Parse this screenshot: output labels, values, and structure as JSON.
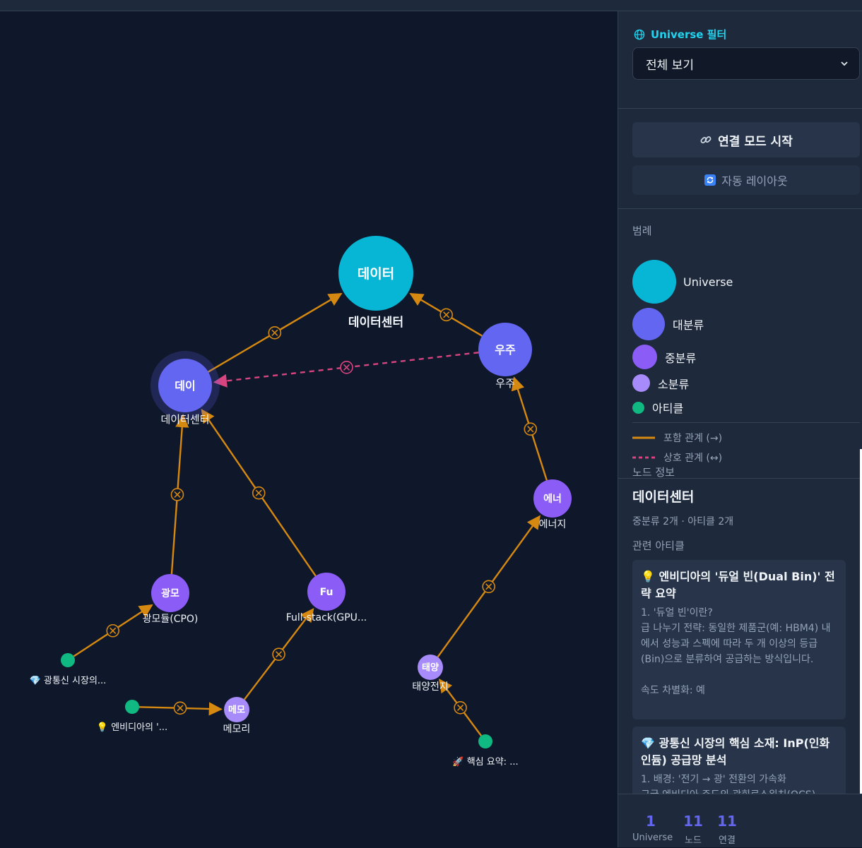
{
  "colors": {
    "universe": "#06b6d4",
    "major": "#6366f1",
    "middle": "#8b5cf6",
    "minor": "#a78bfa",
    "article": "#10b981",
    "contains": "#d68910",
    "mutual": "#d6457f"
  },
  "graph": {
    "nodes": [
      {
        "id": "universe-dc",
        "type": "universe",
        "label": "데이터",
        "caption": "데이터센터"
      },
      {
        "id": "major-dc",
        "type": "major",
        "label": "데이",
        "caption": "데이터센터",
        "selected": true
      },
      {
        "id": "major-space",
        "type": "major",
        "label": "우주",
        "caption": "우주"
      },
      {
        "id": "mid-energy",
        "type": "middle",
        "label": "에너",
        "caption": "에너지"
      },
      {
        "id": "mid-optical",
        "type": "middle",
        "label": "광모",
        "caption": "광모듈(CPO)"
      },
      {
        "id": "mid-fullstack",
        "type": "middle",
        "label": "Fu",
        "caption": "Full-stack(GPU..."
      },
      {
        "id": "minor-memory",
        "type": "minor",
        "label": "메모",
        "caption": "메모리"
      },
      {
        "id": "minor-solar",
        "type": "minor",
        "label": "태양",
        "caption": "태양전지"
      },
      {
        "id": "art-optical",
        "type": "article",
        "icon": "💎",
        "caption": "광통신 시장의..."
      },
      {
        "id": "art-nvidia",
        "type": "article",
        "icon": "💡",
        "caption": "엔비디아의 '..."
      },
      {
        "id": "art-core",
        "type": "article",
        "icon": "🚀",
        "caption": "핵심 요약: ..."
      }
    ],
    "edges": [
      {
        "from": "major-dc",
        "to": "universe-dc",
        "kind": "contains"
      },
      {
        "from": "major-space",
        "to": "universe-dc",
        "kind": "contains"
      },
      {
        "from": "major-space",
        "to": "major-dc",
        "kind": "mutual"
      },
      {
        "from": "mid-optical",
        "to": "major-dc",
        "kind": "contains"
      },
      {
        "from": "mid-fullstack",
        "to": "major-dc",
        "kind": "contains"
      },
      {
        "from": "mid-energy",
        "to": "major-space",
        "kind": "contains"
      },
      {
        "from": "minor-solar",
        "to": "mid-energy",
        "kind": "contains"
      },
      {
        "from": "minor-memory",
        "to": "mid-fullstack",
        "kind": "contains"
      },
      {
        "from": "art-optical",
        "to": "mid-optical",
        "kind": "contains"
      },
      {
        "from": "art-nvidia",
        "to": "minor-memory",
        "kind": "contains"
      },
      {
        "from": "art-core",
        "to": "minor-solar",
        "kind": "contains"
      }
    ]
  },
  "sidebar": {
    "filter": {
      "icon": "globe-icon",
      "title": "Universe 필터",
      "selected": "전체 보기"
    },
    "actions": {
      "connect": {
        "icon": "link-icon",
        "label": "연결 모드 시작"
      },
      "layout": {
        "icon": "refresh-icon",
        "label": "자동 레이아웃"
      }
    },
    "legend": {
      "title": "범례",
      "items": [
        {
          "label": "Universe"
        },
        {
          "label": "대분류"
        },
        {
          "label": "중분류"
        },
        {
          "label": "소분류"
        },
        {
          "label": "아티클"
        }
      ],
      "lines": [
        {
          "label": "포함 관계 (→)"
        },
        {
          "label": "상호 관계 (↔)"
        }
      ]
    },
    "node_info": {
      "section_label": "노드 정보",
      "name": "데이터센터",
      "meta": "중분류 2개 · 아티클 2개",
      "related_label": "관련 아티클",
      "articles": [
        {
          "icon": "💡",
          "title": "엔비디아의 '듀얼 빈(Dual Bin)' 전략 요약",
          "body": "1. '듀얼 빈'이란?\n급 나누기 전략: 동일한 제품군(예: HBM4) 내에서 성능과 스펙에 따라 두 개 이상의 등급(Bin)으로 분류하여 공급하는 방식입니다.\n\n속도 차별화: 예"
        },
        {
          "icon": "💎",
          "title": "광통신 시장의 핵심 소재: InP(인화인듐) 공급망 분석",
          "body": "1. 배경: '전기 → 광' 전환의 가속화\n구글·엔비디아 주도의 광회로스위치(OCS)"
        }
      ]
    },
    "stats": [
      {
        "value": "1",
        "label": "Universe"
      },
      {
        "value": "11",
        "label": "노드"
      },
      {
        "value": "11",
        "label": "연결"
      }
    ]
  }
}
